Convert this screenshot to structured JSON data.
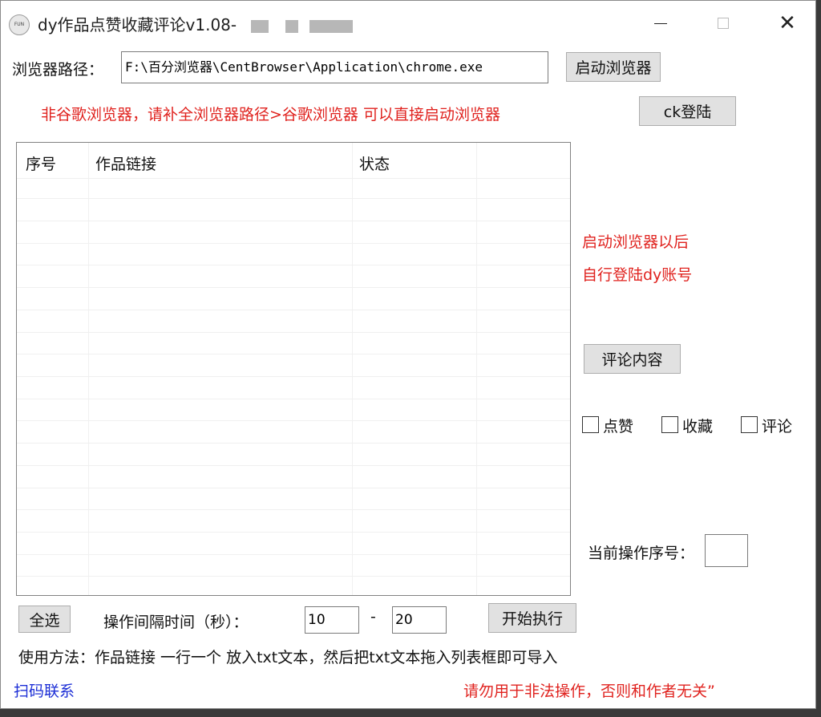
{
  "window": {
    "title": "dy作品点赞收藏评论v1.08-",
    "app_icon_text": "FUN"
  },
  "controls": {
    "browser_path_label": "浏览器路径：",
    "browser_path_value": "F:\\百分浏览器\\CentBrowser\\Application\\chrome.exe",
    "launch_browser_button": "启动浏览器",
    "hint_red": "非谷歌浏览器，请补全浏览器路径>谷歌浏览器 可以直接启动浏览器",
    "ck_login_button": "ck登陆"
  },
  "table": {
    "columns": [
      "序号",
      "作品链接",
      "状态"
    ]
  },
  "side": {
    "note_line1": "启动浏览器以后",
    "note_line2": "自行登陆dy账号",
    "comment_content_button": "评论内容",
    "check_like": "点赞",
    "check_collect": "收藏",
    "check_comment": "评论",
    "current_index_label": "当前操作序号："
  },
  "bottom": {
    "select_all_button": "全选",
    "interval_label": "操作间隔时间（秒）：",
    "interval_min": "10",
    "interval_dash": "-",
    "interval_max": "20",
    "start_button": "开始执行",
    "usage_text": "使用方法：作品链接 一行一个 放入txt文本，然后把txt文本拖入列表框即可导入",
    "scan_contact_link": "扫码联系",
    "warning_text": "请勿用于非法操作，否则和作者无关”"
  }
}
